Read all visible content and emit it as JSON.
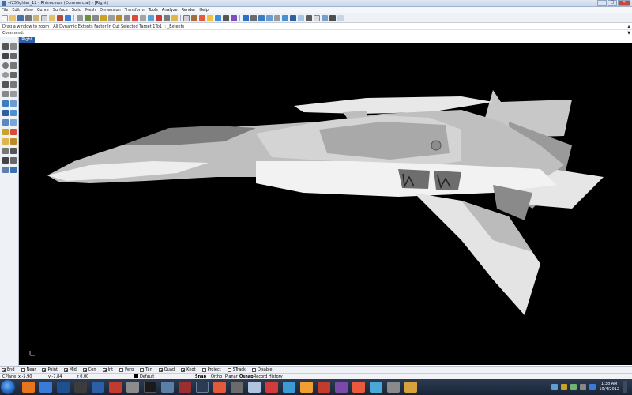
{
  "window": {
    "title": "vf25fighter_12 - Rhinoceros (Commercial) - [Right]",
    "buttons": [
      "–",
      "□",
      "✕"
    ]
  },
  "menu": [
    "File",
    "Edit",
    "View",
    "Curve",
    "Surface",
    "Solid",
    "Mesh",
    "Dimension",
    "Transform",
    "Tools",
    "Analyze",
    "Render",
    "Help"
  ],
  "command_history": "Drag a window to zoom ( All  Dynamic  Extents  Factor  In  Out  Selected  Target  1To1 ): _Extents",
  "command_prompt": "Command:",
  "viewport": {
    "tab_label": "Right",
    "background": "#000000"
  },
  "osnap": {
    "items": [
      {
        "label": "End",
        "checked": true
      },
      {
        "label": "Near",
        "checked": false
      },
      {
        "label": "Point",
        "checked": true
      },
      {
        "label": "Mid",
        "checked": true
      },
      {
        "label": "Cen",
        "checked": true
      },
      {
        "label": "Int",
        "checked": true
      },
      {
        "label": "Perp",
        "checked": false
      },
      {
        "label": "Tan",
        "checked": false
      },
      {
        "label": "Quad",
        "checked": true
      },
      {
        "label": "Knot",
        "checked": true
      },
      {
        "label": "Project",
        "checked": false
      },
      {
        "label": "STrack",
        "checked": false
      },
      {
        "label": "Disable",
        "checked": false
      }
    ]
  },
  "status": {
    "cplane": "CPlane",
    "x": "x -5.90",
    "y": "y -7.84",
    "z": "z 0.00",
    "layer": "Default",
    "toggles": [
      "Snap",
      "Ortho",
      "Planar",
      "Osnap",
      "Record History"
    ]
  },
  "taskbar": {
    "time": "1:38 AM",
    "date": "10/4/2012"
  },
  "colors": {
    "accent": "#2e5fa8",
    "viewport_bg": "#000000",
    "model": "#d8d8d8"
  }
}
